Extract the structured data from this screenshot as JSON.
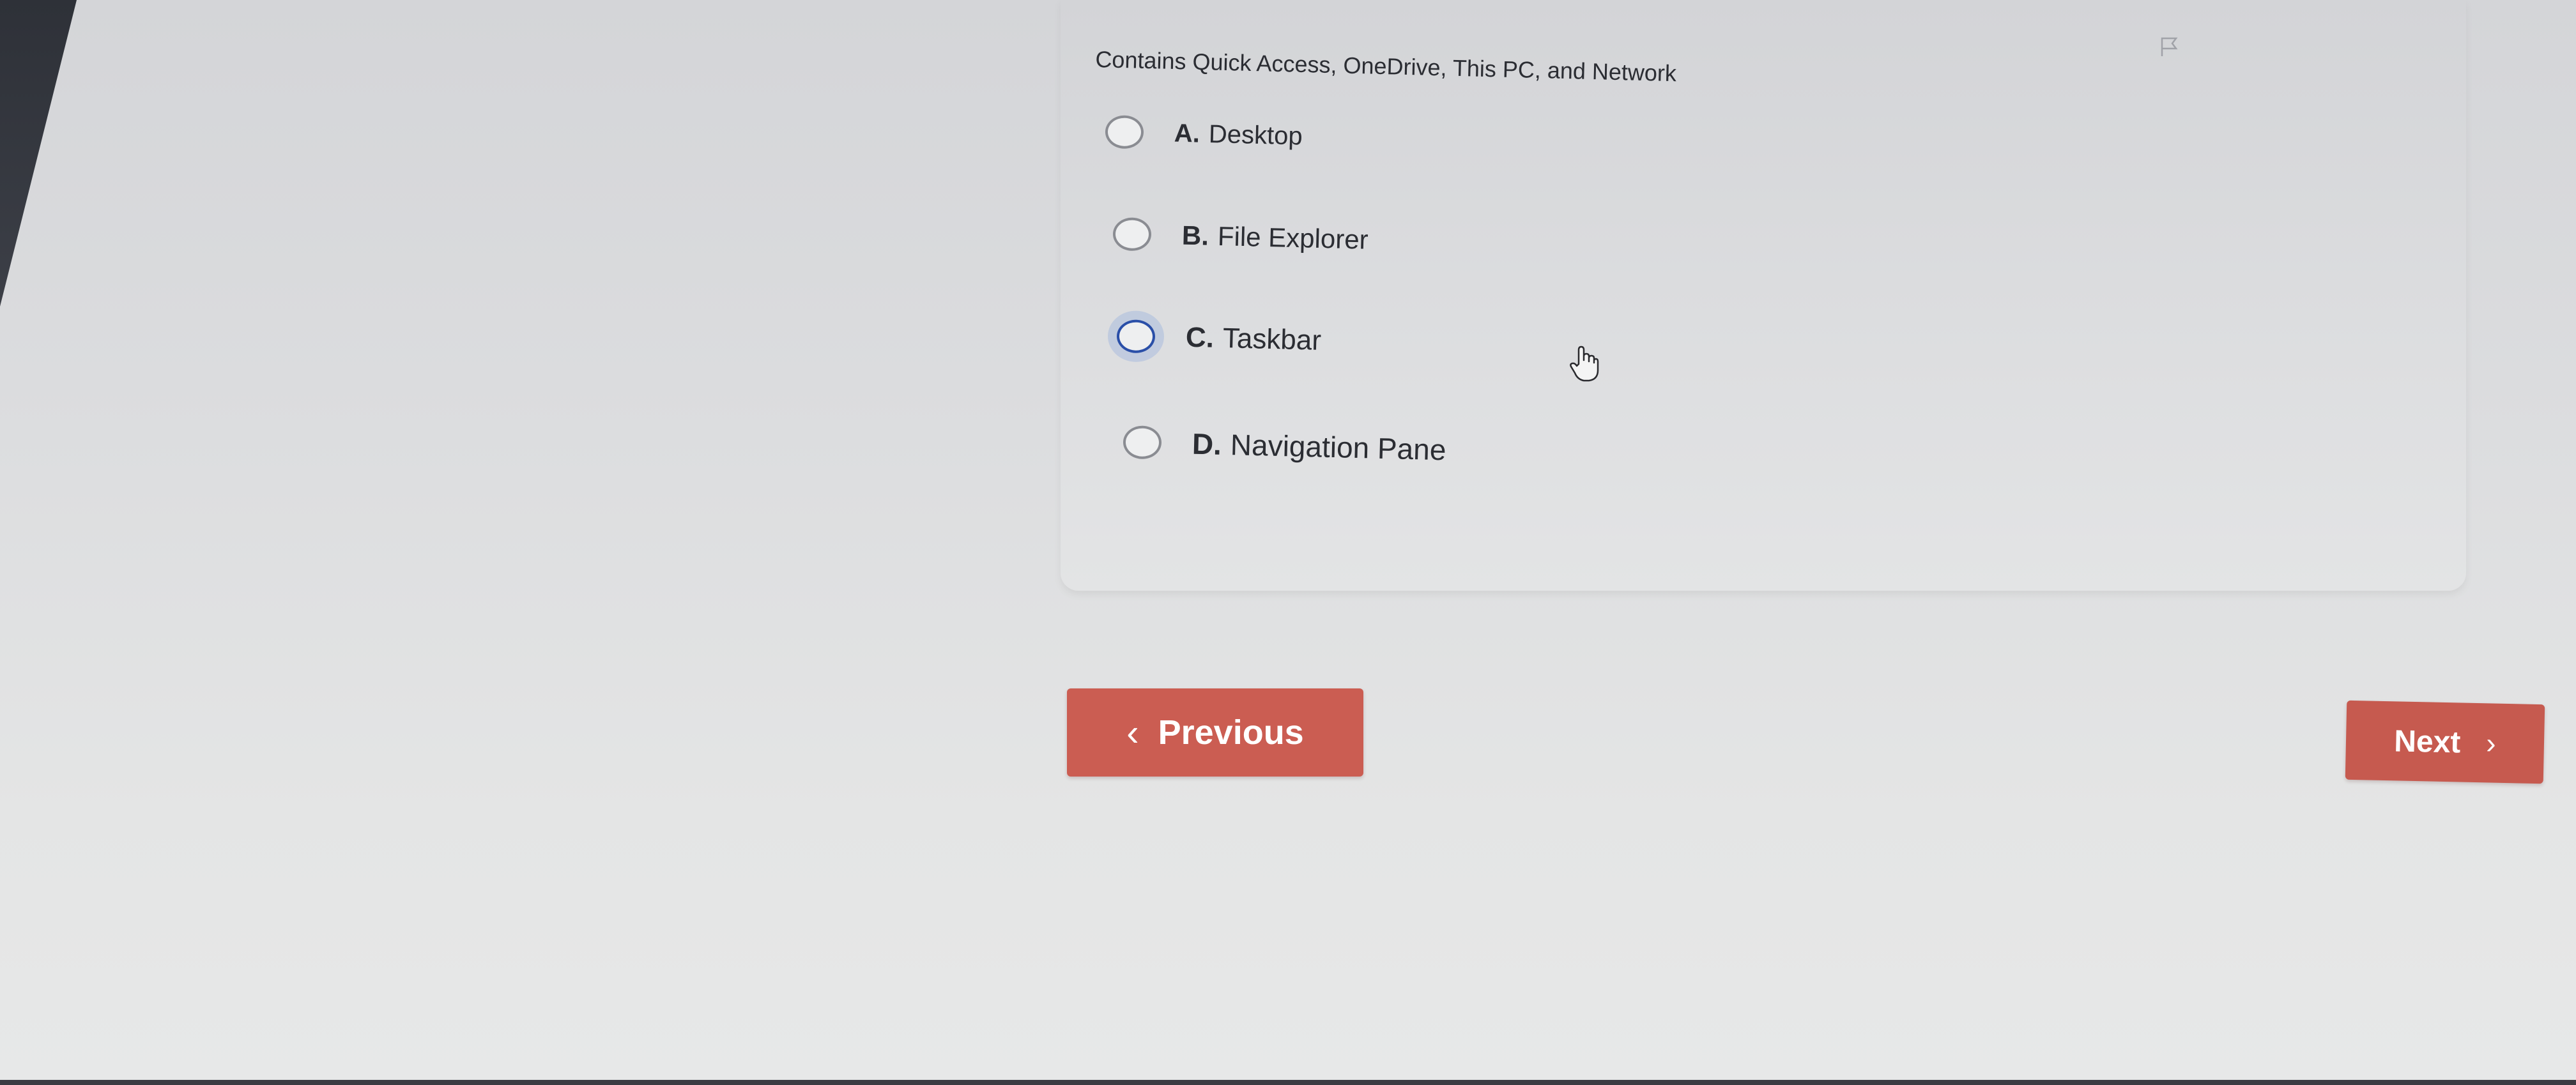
{
  "question": {
    "text": "Contains Quick Access, OneDrive, This PC, and Network"
  },
  "options": [
    {
      "letter": "A.",
      "text": "Desktop",
      "selected": false
    },
    {
      "letter": "B.",
      "text": "File Explorer",
      "selected": false
    },
    {
      "letter": "C.",
      "text": "Taskbar",
      "selected": false,
      "focused": true
    },
    {
      "letter": "D.",
      "text": "Navigation Pane",
      "selected": false
    }
  ],
  "navigation": {
    "previous_label": "Previous",
    "next_label": "Next"
  },
  "colors": {
    "button": "#cb5d52",
    "focus_ring": "#2a4fa8"
  },
  "icons": {
    "flag": "flag-icon",
    "cursor": "hand-pointer-icon",
    "prev": "chevron-left-icon",
    "next": "chevron-right-icon"
  }
}
